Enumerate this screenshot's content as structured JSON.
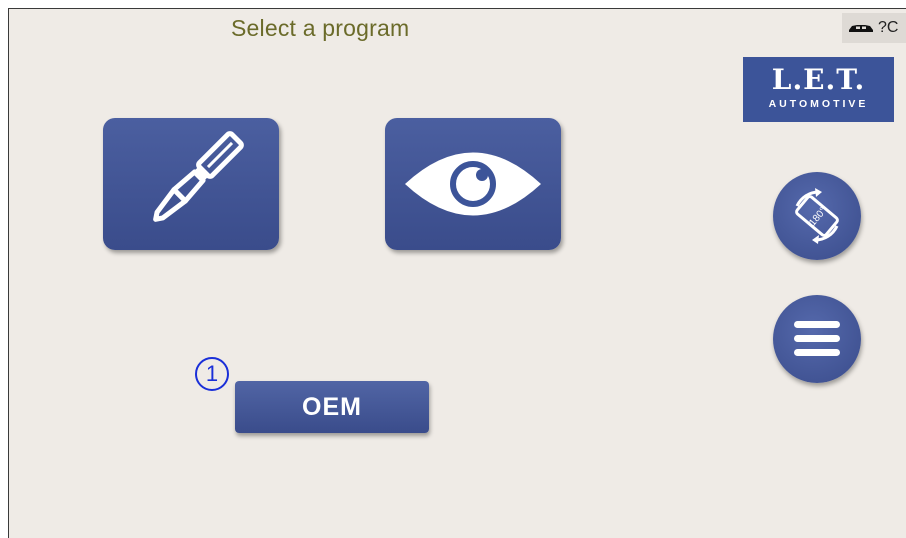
{
  "header": {
    "title": "Select a program",
    "status_text": "?C",
    "status_icon": "car-icon"
  },
  "logo": {
    "main": "L.E.T.",
    "sub": "AUTOMOTIVE"
  },
  "tiles": [
    {
      "icon": "screwdriver-icon"
    },
    {
      "icon": "eye-icon"
    }
  ],
  "side_buttons": {
    "rotate": {
      "icon": "rotate-screen-icon",
      "label": "180°"
    },
    "menu": {
      "icon": "hamburger-menu-icon"
    }
  },
  "oem_button": {
    "label": "OEM",
    "badge": "1"
  },
  "colors": {
    "background": "#efebe6",
    "button": "#3c5499",
    "title": "#6b6b2a",
    "badge": "#1a2fd8"
  }
}
